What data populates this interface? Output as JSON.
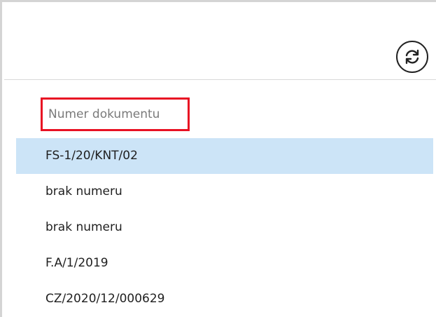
{
  "header": {
    "refresh_icon": "refresh-icon"
  },
  "search": {
    "placeholder": "Numer dokumentu",
    "value": ""
  },
  "documents": {
    "selected_index": 0,
    "items": [
      {
        "label": "FS-1/20/KNT/02"
      },
      {
        "label": "brak numeru"
      },
      {
        "label": "brak numeru"
      },
      {
        "label": "F.A/1/2019"
      },
      {
        "label": "CZ/2020/12/000629"
      }
    ]
  },
  "colors": {
    "selection": "#cce4f7",
    "highlight_border": "#e81123",
    "text": "#1f1f1f",
    "placeholder": "#7a7a7a"
  }
}
